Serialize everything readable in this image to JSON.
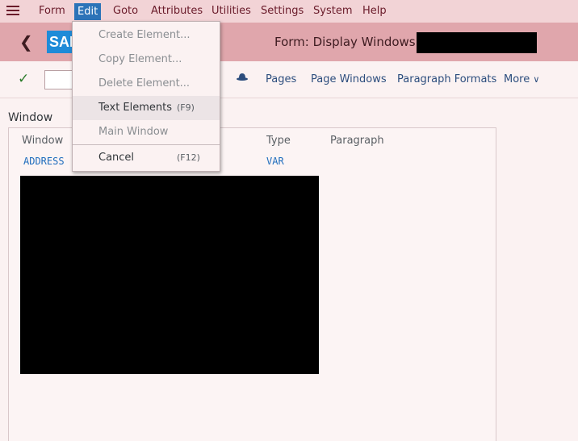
{
  "menubar": {
    "items": [
      {
        "label": "Form"
      },
      {
        "label": "Edit"
      },
      {
        "label": "Goto"
      },
      {
        "label": "Attributes"
      },
      {
        "label": "Utilities"
      },
      {
        "label": "Settings"
      },
      {
        "label": "System"
      },
      {
        "label": "Help"
      }
    ],
    "active_item": "Edit"
  },
  "shell": {
    "title": "Form: Display Windows: Z",
    "logo_text": "SAP"
  },
  "toolbar": {
    "command_field_value": "",
    "links": [
      {
        "label": "Pages"
      },
      {
        "label": "Page Windows"
      },
      {
        "label": "Paragraph Formats"
      },
      {
        "label": "More"
      }
    ]
  },
  "content": {
    "section_title": "Window",
    "columns": [
      "Window",
      "Type",
      "Paragraph"
    ],
    "rows": [
      {
        "window": "ADDRESS",
        "type": "VAR",
        "paragraph": ""
      }
    ]
  },
  "edit_menu": {
    "items": [
      {
        "label": "Create Element...",
        "shortcut": "",
        "enabled": false
      },
      {
        "label": "Copy Element...",
        "shortcut": "",
        "enabled": false
      },
      {
        "label": "Delete Element...",
        "shortcut": "",
        "enabled": false
      },
      {
        "label": "Text Elements",
        "shortcut": "(F9)",
        "enabled": true,
        "highlighted": true
      },
      {
        "label": "Main Window",
        "shortcut": "",
        "enabled": false
      },
      {
        "label": "Cancel",
        "shortcut": "(F12)",
        "enabled": true
      }
    ]
  },
  "icons": {
    "menu": "hamburger-icon",
    "back": "back-arrow-icon",
    "check": "checkmark-icon",
    "hat": "hat-icon",
    "more": "chevron-down-icon"
  },
  "colors": {
    "menubar_bg": "#f2d3d6",
    "shell_bg": "#e0a6ac",
    "active_menu": "#2c73b8",
    "link": "#2c4d7d",
    "check": "#2b7c2b"
  }
}
